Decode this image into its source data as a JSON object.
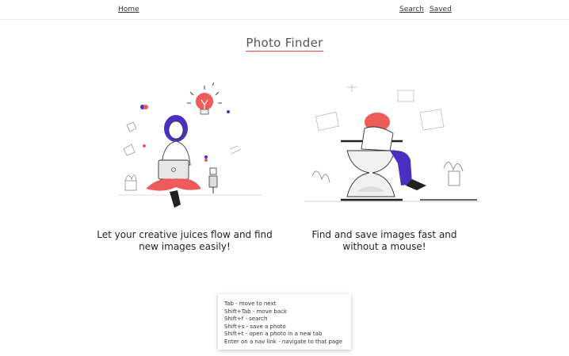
{
  "nav": {
    "home": "Home",
    "search": "Search",
    "saved": "Saved"
  },
  "page": {
    "title": "Photo Finder"
  },
  "features": [
    {
      "caption": "Let your creative juices flow and find new images easily!",
      "icon": "woman-with-laptop-illustration"
    },
    {
      "caption": "Find and save images fast and without a mouse!",
      "icon": "woman-on-hourglass-illustration"
    }
  ],
  "shortcuts": [
    "Tab - move to next",
    "Shift+Tab - move back",
    "Shift+f - search",
    "Shift+s - save a photo",
    "Shift+t - open a photo in a new tab",
    "Enter on a nav link - navigate to that page"
  ],
  "colors": {
    "accent": "#e04a4a",
    "purple": "#4b2fc0",
    "red": "#ef5a5a"
  }
}
